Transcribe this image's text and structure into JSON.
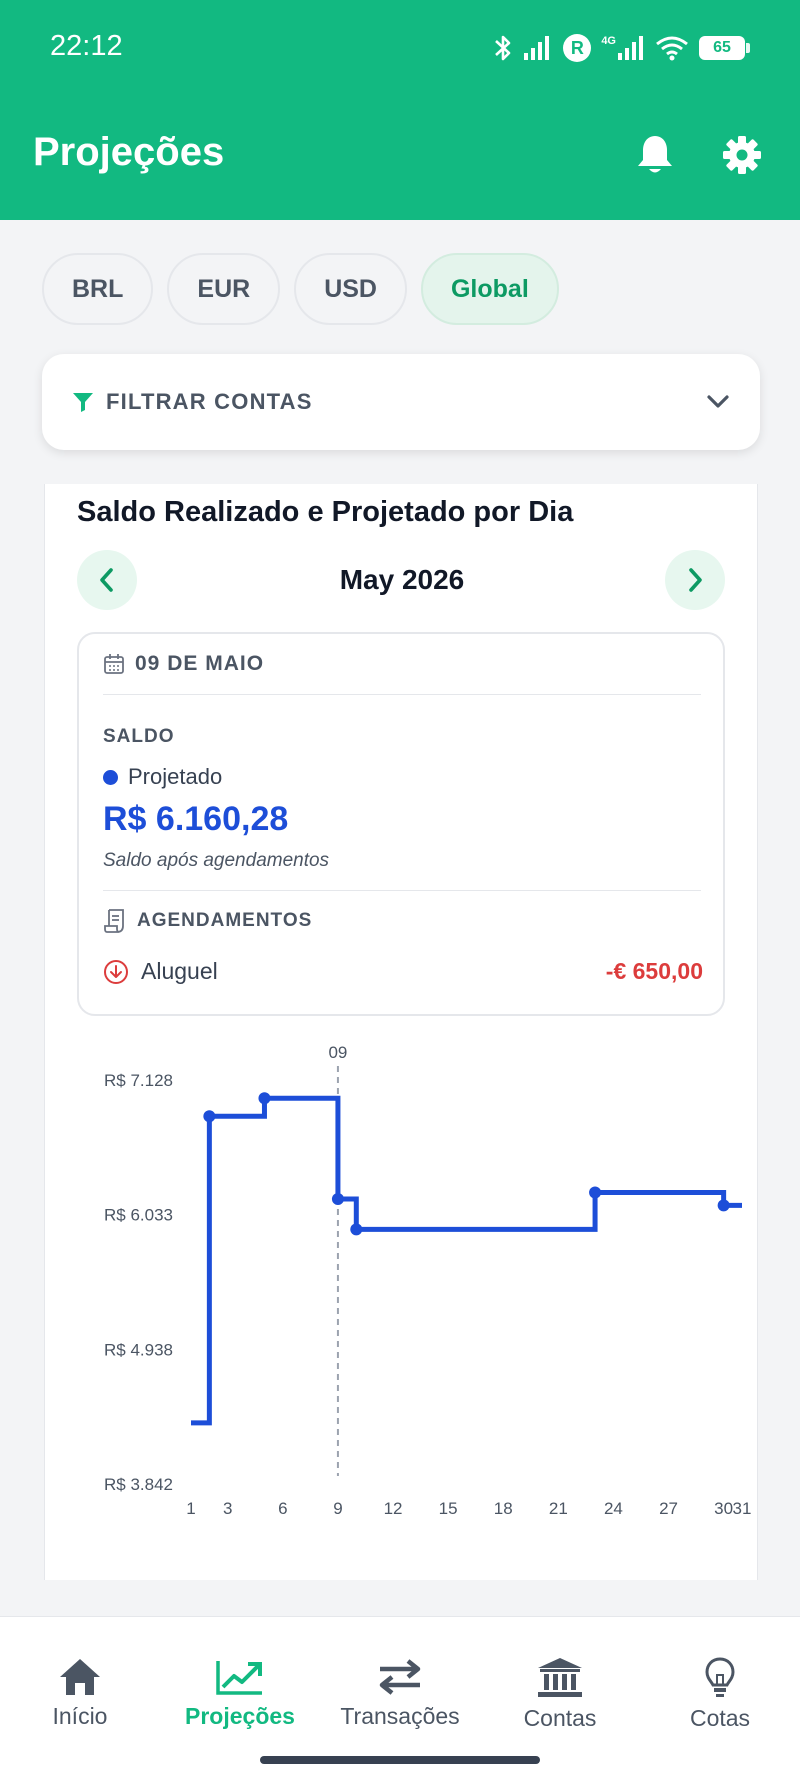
{
  "status_bar": {
    "time": "22:12",
    "battery": "65",
    "network": "4G",
    "carrier_badge": "R"
  },
  "header": {
    "title": "Projeções",
    "icons": [
      "bell-icon",
      "gear-icon"
    ]
  },
  "currency_chips": [
    {
      "label": "BRL",
      "active": false
    },
    {
      "label": "EUR",
      "active": false
    },
    {
      "label": "USD",
      "active": false
    },
    {
      "label": "Global",
      "active": true
    }
  ],
  "filter": {
    "label": "FILTRAR CONTAS"
  },
  "card": {
    "title": "Saldo Realizado e Projetado por Dia",
    "month": "May 2026"
  },
  "detail": {
    "date": "09 DE MAIO",
    "saldo_label": "SALDO",
    "series_label": "Projetado",
    "value": "R$ 6.160,28",
    "subtitle": "Saldo após agendamentos",
    "schedules_label": "AGENDAMENTOS",
    "schedules": [
      {
        "name": "Aluguel",
        "amount": "-€ 650,00"
      }
    ]
  },
  "chart_data": {
    "type": "line",
    "step": true,
    "marker_label": "09",
    "marker_x": 9,
    "y_tick_labels": [
      "R$ 7.128",
      "R$ 6.033",
      "R$ 4.938",
      "R$ 3.842"
    ],
    "y_ticks": [
      7128,
      6033,
      4938,
      3842
    ],
    "ylim": [
      3842,
      7128
    ],
    "x_ticks": [
      1,
      3,
      6,
      9,
      12,
      15,
      18,
      21,
      24,
      27,
      30,
      31
    ],
    "xlim": [
      1,
      31
    ],
    "series": [
      {
        "name": "Projetado",
        "color": "#1d4ed8",
        "points": [
          {
            "x": 1,
            "y": 4339
          },
          {
            "x": 2,
            "y": 6833
          },
          {
            "x": 5,
            "y": 6980
          },
          {
            "x": 9,
            "y": 6160
          },
          {
            "x": 10,
            "y": 5913
          },
          {
            "x": 23,
            "y": 6213
          },
          {
            "x": 30,
            "y": 6108
          },
          {
            "x": 31,
            "y": 6108
          }
        ]
      }
    ],
    "dot_x": [
      2,
      5,
      9,
      10,
      23,
      30
    ]
  },
  "bottom_nav": [
    {
      "label": "Início",
      "icon": "home-icon",
      "active": false
    },
    {
      "label": "Projeções",
      "icon": "trending-up-icon",
      "active": true
    },
    {
      "label": "Transações",
      "icon": "swap-arrows-icon",
      "active": false
    },
    {
      "label": "Contas",
      "icon": "bank-icon",
      "active": false
    },
    {
      "label": "Cotas",
      "icon": "lightbulb-icon",
      "active": false
    }
  ]
}
